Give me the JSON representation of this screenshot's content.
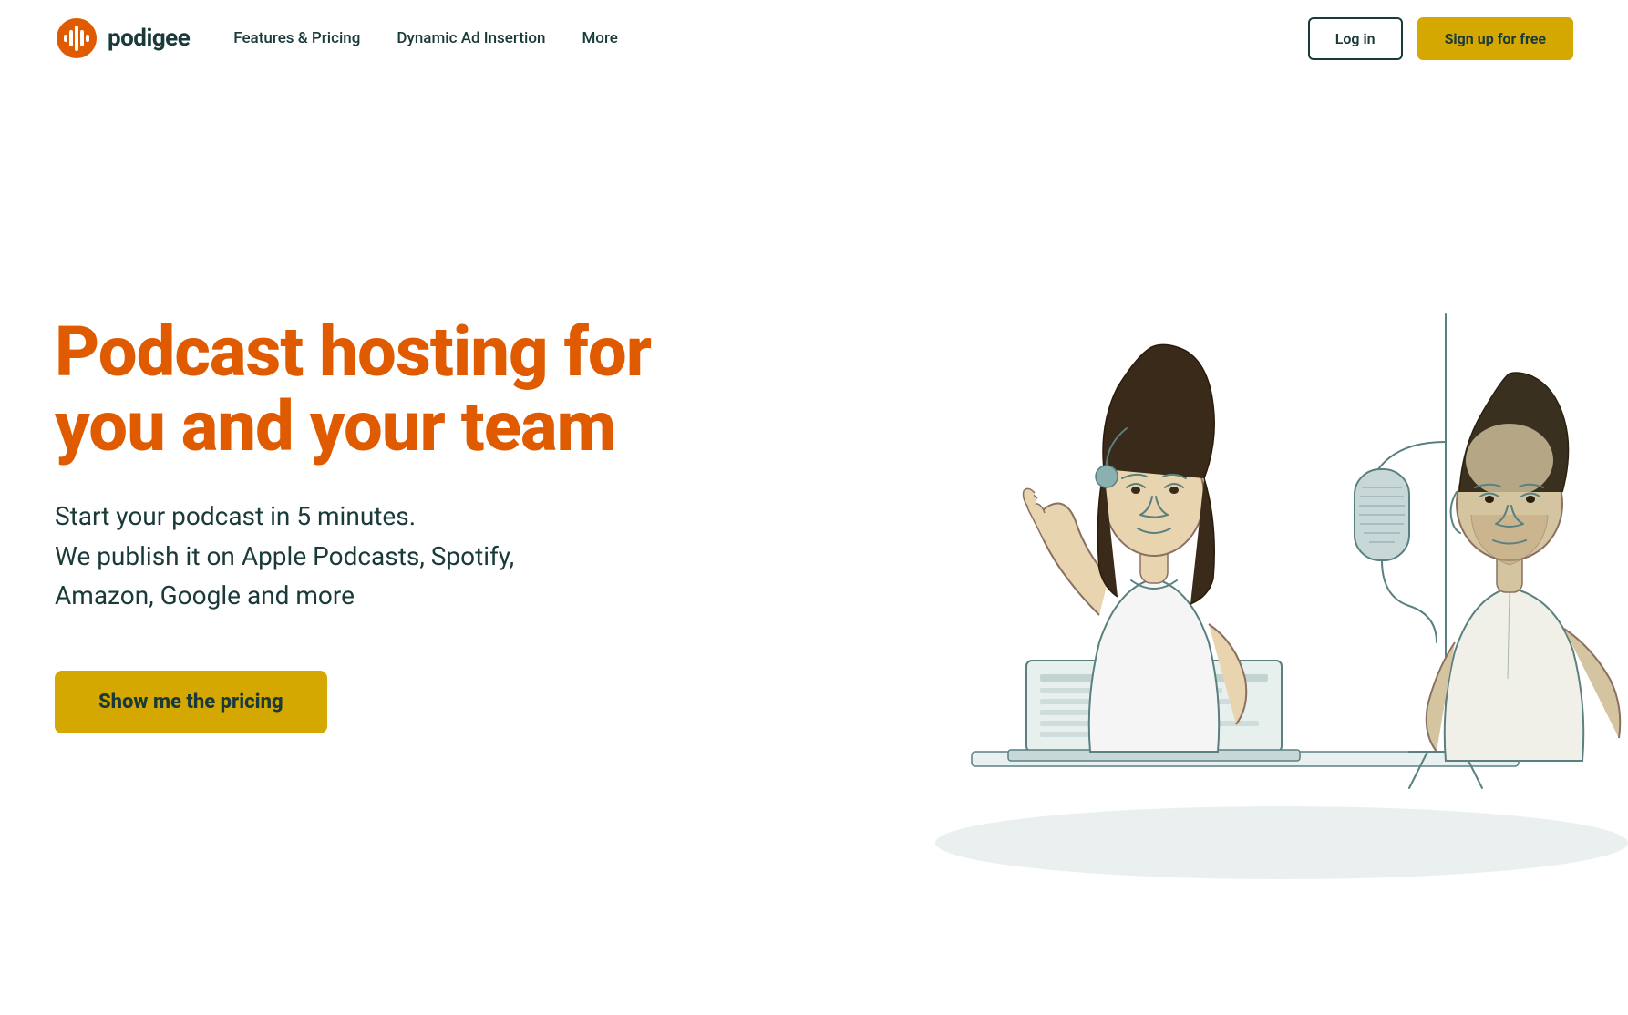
{
  "brand": {
    "name": "podigee",
    "logo_alt": "Podigee logo"
  },
  "nav": {
    "links": [
      {
        "label": "Features & Pricing",
        "id": "features-pricing"
      },
      {
        "label": "Dynamic Ad Insertion",
        "id": "dynamic-ad-insertion"
      },
      {
        "label": "More",
        "id": "more"
      }
    ],
    "login_label": "Log in",
    "signup_label": "Sign up for free"
  },
  "hero": {
    "title_line1": "Podcast hosting for",
    "title_line2": "you and your team",
    "subtitle_line1": "Start your podcast in 5 minutes.",
    "subtitle_line2": "We publish it on Apple Podcasts, Spotify,",
    "subtitle_line3": "Amazon, Google and more",
    "cta_label": "Show me the pricing"
  },
  "colors": {
    "accent_orange": "#e05a00",
    "accent_yellow": "#d4a800",
    "dark_teal": "#1a3a3a",
    "illustration_teal": "#5a8a8a"
  }
}
